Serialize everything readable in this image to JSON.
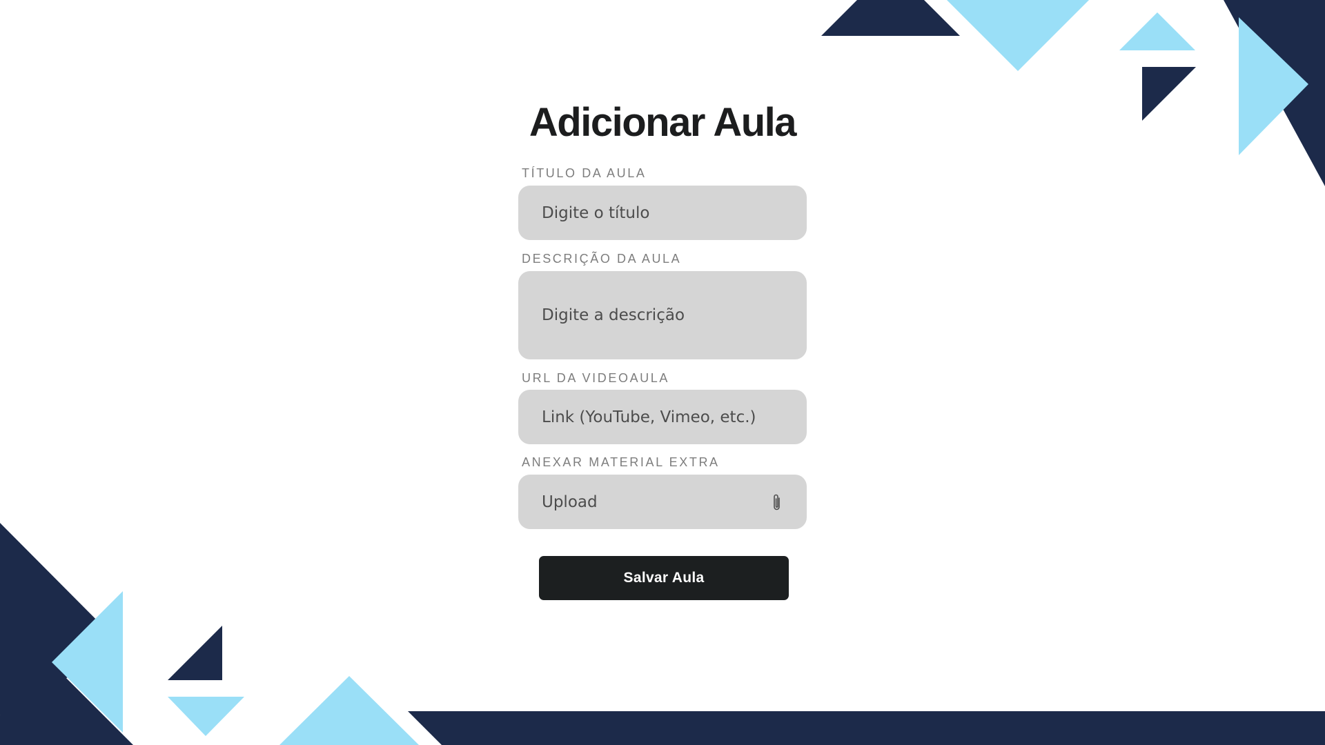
{
  "page": {
    "title": "Adicionar Aula"
  },
  "form": {
    "title_field": {
      "label": "TÍTULO DA AULA",
      "placeholder": "Digite o título"
    },
    "description_field": {
      "label": "DESCRIÇÃO DA AULA",
      "placeholder": "Digite a descrição"
    },
    "url_field": {
      "label": "URL DA VIDEOAULA",
      "placeholder": "Link (YouTube, Vimeo, etc.)"
    },
    "attachment_field": {
      "label": "ANEXAR MATERIAL EXTRA",
      "placeholder": "Upload",
      "icon": "paperclip-icon"
    },
    "save_label": "Salvar Aula"
  },
  "theme": {
    "dark_navy": "#1c2a4a",
    "light_blue": "#9adff7",
    "field_bg": "#d5d5d5",
    "button_bg": "#1c1f20"
  }
}
